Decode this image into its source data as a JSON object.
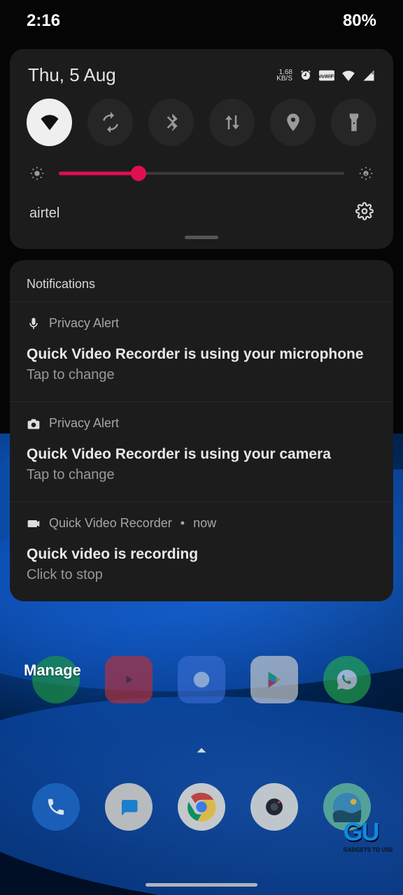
{
  "status_bar": {
    "time": "2:16",
    "battery": "80%"
  },
  "qs": {
    "date": "Thu, 5 Aug",
    "netspeed_top": "1.68",
    "netspeed_bottom": "KB/S",
    "carrier": "airtel",
    "brightness_pct": 28,
    "tiles": {
      "wifi": "wifi",
      "rotate": "auto-rotate",
      "bluetooth": "bluetooth",
      "data": "mobile-data",
      "location": "location",
      "flashlight": "flashlight"
    }
  },
  "notifications": {
    "section_title": "Notifications",
    "items": [
      {
        "icon": "microphone-icon",
        "app": "Privacy Alert",
        "time": "",
        "title": "Quick Video Recorder is using your microphone",
        "sub": "Tap to change"
      },
      {
        "icon": "camera-icon",
        "app": "Privacy Alert",
        "time": "",
        "title": "Quick Video Recorder is using your camera",
        "sub": "Tap to change"
      },
      {
        "icon": "video-icon",
        "app": "Quick Video Recorder",
        "time": "now",
        "title": "Quick video is recording",
        "sub": "Click to stop"
      }
    ]
  },
  "manage_label": "Manage",
  "watermark": {
    "brand": "GU",
    "tagline": "GADGETS TO USE"
  }
}
